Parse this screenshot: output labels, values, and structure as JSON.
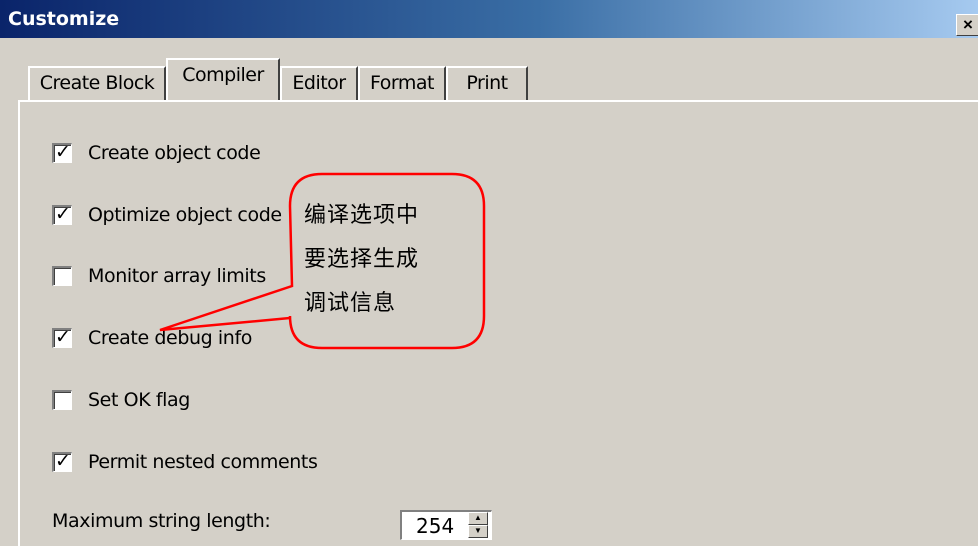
{
  "window": {
    "title": "Customize",
    "close_glyph": "×"
  },
  "tabs": [
    {
      "label": "Create Block"
    },
    {
      "label": "Compiler"
    },
    {
      "label": "Editor"
    },
    {
      "label": "Format"
    },
    {
      "label": "Print"
    }
  ],
  "active_tab": "Compiler",
  "options": [
    {
      "label": "Create object code",
      "checked": true
    },
    {
      "label": "Optimize object code",
      "checked": true
    },
    {
      "label": "Monitor array limits",
      "checked": false
    },
    {
      "label": "Create debug info",
      "checked": true
    },
    {
      "label": "Set OK flag",
      "checked": false
    },
    {
      "label": "Permit nested comments",
      "checked": true
    }
  ],
  "max_string": {
    "label": "Maximum string length:",
    "value": "254"
  },
  "callout": {
    "lines": [
      "编译选项中",
      "要选择生成",
      "调试信息"
    ],
    "border_color": "#ff0000"
  },
  "colors": {
    "title_gradient_start": "#0a246a",
    "title_gradient_end": "#a6caf0",
    "dialog_bg": "#d4d0c8"
  }
}
